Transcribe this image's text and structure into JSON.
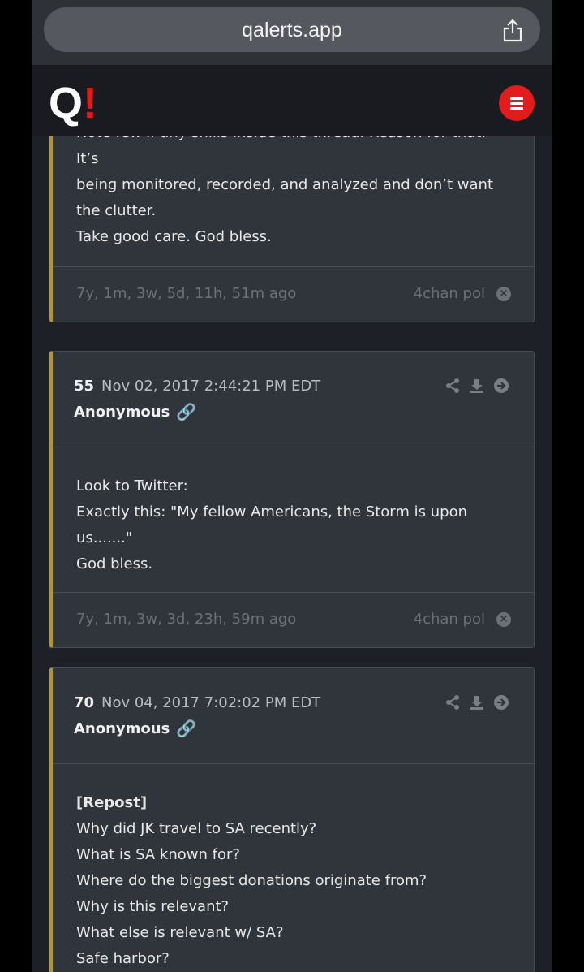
{
  "browser": {
    "url": "qalerts.app",
    "share_icon": "share-icon"
  },
  "header": {
    "logo_q": "Q",
    "logo_bang": "!",
    "menu_icon": "hamburger-icon",
    "accent_color": "#e01c1c"
  },
  "posts": [
    {
      "body_lines": [
        "Note few if any shills inside this thread. Reason for that. It’s",
        "being monitored, recorded, and analyzed and don’t want",
        "the clutter.",
        "Take good care. God bless."
      ],
      "ago": "7y, 1m, 3w, 5d, 11h, 51m ago",
      "source": "4chan pol"
    },
    {
      "number": "55",
      "date": "Nov 02, 2017 2:44:21 PM EDT",
      "author": "Anonymous",
      "body_lines": [
        "Look to Twitter:",
        "Exactly this: \"My fellow Americans, the Storm is upon us.......\"",
        "God bless."
      ],
      "ago": "7y, 1m, 3w, 3d, 23h, 59m ago",
      "source": "4chan pol"
    },
    {
      "number": "70",
      "date": "Nov 04, 2017 7:02:02 PM EDT",
      "author": "Anonymous",
      "body_lines": [
        "[Repost]",
        "Why did JK travel to SA recently?",
        "What is SA known for?",
        "Where do the biggest donations originate from?",
        "Why is this relevant?",
        "What else is relevant w/ SA?",
        "Safe harbor?"
      ]
    }
  ],
  "colors": {
    "card_accent": "#b8942a",
    "link": "#3d8ee8"
  }
}
